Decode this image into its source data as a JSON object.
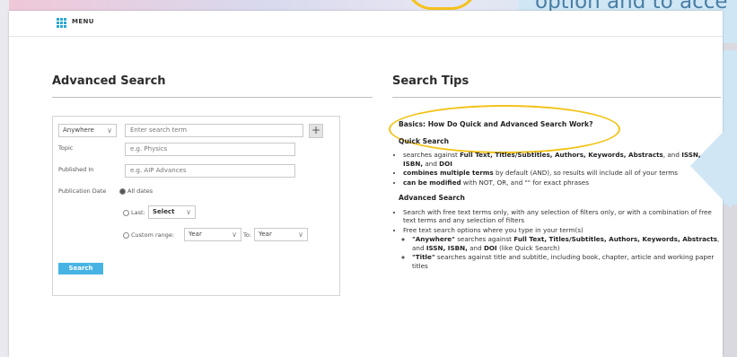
{
  "callout": {
    "text": "option and to acce"
  },
  "menu": {
    "label": "MENU"
  },
  "advanced": {
    "title": "Advanced Search",
    "field_select": "Anywhere",
    "search_placeholder": "Enter search term",
    "topic_label": "Topic",
    "topic_placeholder": "e.g. Physics",
    "published_label": "Published In",
    "published_placeholder": "e.g. AIP Advances",
    "pubdate_label": "Publication Date",
    "all_dates": "All dates",
    "last_label": "Last:",
    "last_select": "Select",
    "custom_label": "Custom range:",
    "from_select": "Year",
    "to_label": "To:",
    "to_select": "Year",
    "search_button": "Search"
  },
  "tips": {
    "title": "Search Tips",
    "basics": "Basics: How Do Quick and Advanced Search Work?",
    "quick_heading": "Quick Search",
    "adv_heading": "Advanced Search"
  }
}
